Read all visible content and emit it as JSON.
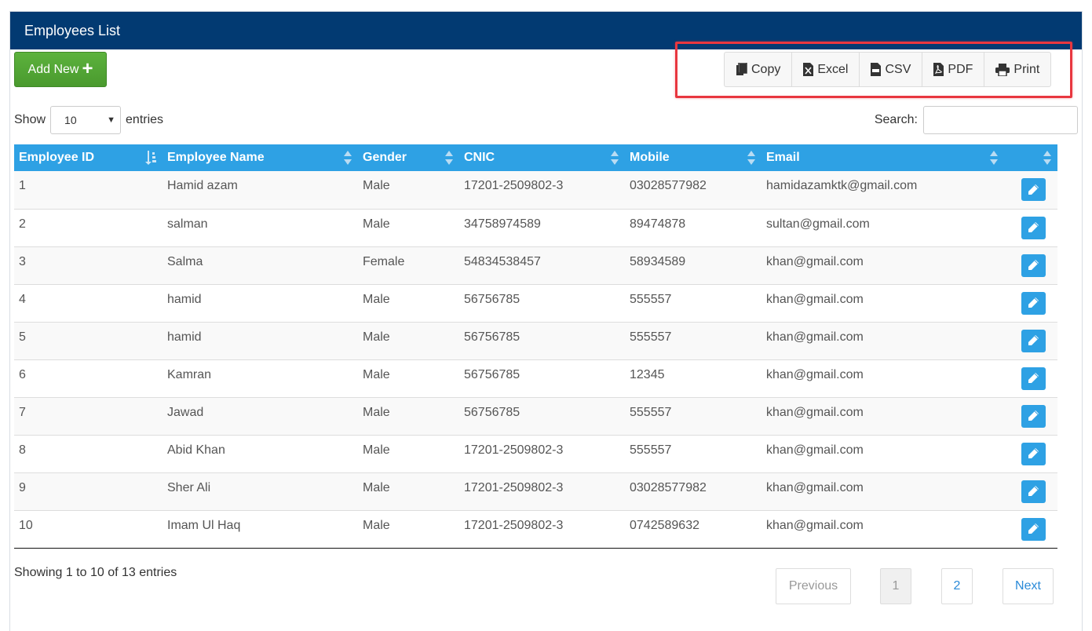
{
  "panel": {
    "title": "Employees List"
  },
  "toolbar": {
    "add_label": "Add New",
    "add_icon": "plus-icon",
    "export_buttons": [
      {
        "label": "Copy",
        "icon": "copy-icon"
      },
      {
        "label": "Excel",
        "icon": "excel-file-icon"
      },
      {
        "label": "CSV",
        "icon": "csv-file-icon"
      },
      {
        "label": "PDF",
        "icon": "pdf-file-icon"
      },
      {
        "label": "Print",
        "icon": "printer-icon"
      }
    ],
    "highlight_color": "#e8373f"
  },
  "length": {
    "show": "Show",
    "value": "10",
    "entries": "entries"
  },
  "search": {
    "label": "Search:",
    "value": ""
  },
  "table": {
    "columns": [
      "Employee ID",
      "Employee Name",
      "Gender",
      "CNIC",
      "Mobile",
      "Email",
      ""
    ],
    "rows": [
      [
        "1",
        "Hamid azam",
        "Male",
        "17201-2509802-3",
        "03028577982",
        "hamidazamktk@gmail.com"
      ],
      [
        "2",
        "salman",
        "Male",
        "34758974589",
        "89474878",
        "sultan@gmail.com"
      ],
      [
        "3",
        "Salma",
        "Female",
        "54834538457",
        "58934589",
        "khan@gmail.com"
      ],
      [
        "4",
        "hamid",
        "Male",
        "56756785",
        "555557",
        "khan@gmail.com"
      ],
      [
        "5",
        "hamid",
        "Male",
        "56756785",
        "555557",
        "khan@gmail.com"
      ],
      [
        "6",
        "Kamran",
        "Male",
        "56756785",
        "12345",
        "khan@gmail.com"
      ],
      [
        "7",
        "Jawad",
        "Male",
        "56756785",
        "555557",
        "khan@gmail.com"
      ],
      [
        "8",
        "Abid Khan",
        "Male",
        "17201-2509802-3",
        "555557",
        "khan@gmail.com"
      ],
      [
        "9",
        "Sher Ali",
        "Male",
        "17201-2509802-3",
        "03028577982",
        "khan@gmail.com"
      ],
      [
        "10",
        "Imam Ul Haq",
        "Male",
        "17201-2509802-3",
        "0742589632",
        "khan@gmail.com"
      ]
    ]
  },
  "footer": {
    "info": "Showing 1 to 10 of 13 entries",
    "previous": "Previous",
    "pages": [
      "1",
      "2"
    ],
    "current_page": "1",
    "next": "Next"
  },
  "colors": {
    "header_bg": "#023a72",
    "table_header_bg": "#2ea1e4",
    "add_button": "#5cb23d",
    "edit_button": "#2ea1e4",
    "link": "#2a8ad8"
  }
}
